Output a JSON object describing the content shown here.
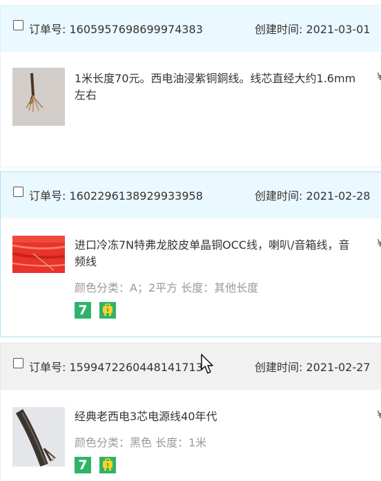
{
  "labels": {
    "order_no_prefix": "订单号:",
    "created_prefix": "创建时间:",
    "currency": "¥"
  },
  "orders": [
    {
      "order_no": "1605957698699974383",
      "created": "2021-03-01",
      "item": {
        "title": "1米长度70元。西电油浸紫铜銅线。线芯直经大约1.6mm左右",
        "spec": ""
      }
    },
    {
      "order_no": "1602296138929933958",
      "created": "2021-02-28",
      "item": {
        "title": "进口冷冻7N特弗龙胶皮单晶铜OCC线，喇叭/音箱线，音频线",
        "spec": "颜色分类：A；2平方  长度：其他长度",
        "badges": [
          "seven-day-return-icon",
          "guarantee-icon"
        ]
      }
    },
    {
      "order_no": "1599472260448141713",
      "created": "2021-02-27",
      "item": {
        "title": "经典老西电3芯电源线40年代",
        "spec": "颜色分类：黑色  长度：1米",
        "badges": [
          "seven-day-return-icon",
          "guarantee-icon"
        ]
      }
    }
  ],
  "badge_text": {
    "seven": "7"
  },
  "colors": {
    "header_light_blue": "#eaf8ff",
    "header_gray": "#f1f1f1",
    "badge_green": "#2fb36a",
    "spec_gray": "#999999"
  }
}
